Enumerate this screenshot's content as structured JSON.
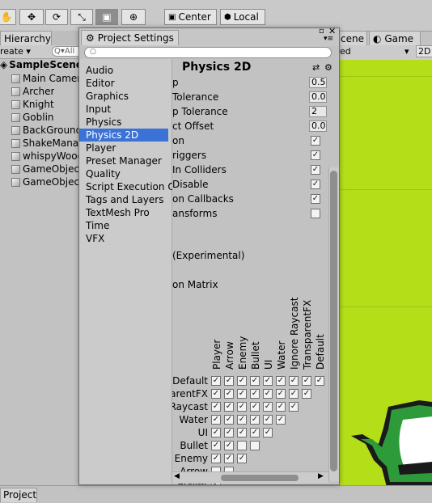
{
  "toolbar": {
    "pivot_label": "Center",
    "space_label": "Local"
  },
  "hierarchy": {
    "tab_label": "Hierarchy",
    "create_label": "reate ▾",
    "search_placeholder": "All",
    "scene_name": "SampleScene",
    "items": [
      "Main Camera",
      "Archer",
      "Knight",
      "Goblin",
      "BackGround",
      "ShakeManager",
      "whispyWood",
      "GameObject",
      "GameObject"
    ]
  },
  "scene_view": {
    "tab_label": "cene",
    "game_tab_label": "Game",
    "shading_label": "ed",
    "mode_2d": "2D",
    "bg_color": "#b4df18"
  },
  "bottom": {
    "project_tab": "Project"
  },
  "project_settings": {
    "window_title": "Project Settings",
    "search_placeholder": "",
    "categories": [
      "Audio",
      "Editor",
      "Graphics",
      "Input",
      "Physics",
      "Physics 2D",
      "Player",
      "Preset Manager",
      "Quality",
      "Script Execution O",
      "Tags and Layers",
      "TextMesh Pro",
      "Time",
      "VFX"
    ],
    "selected_category": "Physics 2D",
    "header_title": "Physics 2D",
    "settings": [
      {
        "label": "p",
        "value": "0.5"
      },
      {
        "label": " Tolerance",
        "value": "0.0"
      },
      {
        "label": "p Tolerance",
        "value": "2"
      },
      {
        "label": "ct Offset",
        "value": "0.0"
      },
      {
        "label": "on",
        "checked": true
      },
      {
        "label": "riggers",
        "checked": true
      },
      {
        "label": " In Colliders",
        "checked": true
      },
      {
        "label": " Disable",
        "checked": true
      },
      {
        "label": "on Callbacks",
        "checked": true
      },
      {
        "label": "ansforms",
        "checked": false
      }
    ],
    "experimental_label": " (Experimental)",
    "matrix_label": "on Matrix",
    "matrix_columns": [
      "Player",
      "Arrow",
      "Enemy",
      "Bullet",
      "UI",
      "Water",
      "Ignore Raycast",
      "TransparentFX",
      "Default"
    ],
    "matrix_rows": [
      {
        "label": "Default",
        "checks": [
          true,
          true,
          true,
          true,
          true,
          true,
          true,
          true,
          true
        ]
      },
      {
        "label": "arentFX",
        "checks": [
          true,
          true,
          true,
          true,
          true,
          true,
          true,
          true
        ]
      },
      {
        "label": "Raycast",
        "checks": [
          true,
          true,
          true,
          true,
          true,
          true,
          true
        ]
      },
      {
        "label": "Water",
        "checks": [
          true,
          true,
          true,
          true,
          true,
          true
        ]
      },
      {
        "label": "UI",
        "checks": [
          true,
          true,
          true,
          true,
          true
        ]
      },
      {
        "label": "Bullet",
        "checks": [
          true,
          true,
          false,
          false
        ]
      },
      {
        "label": "Enemy",
        "checks": [
          true,
          true,
          true
        ]
      },
      {
        "label": "Arrow",
        "checks": [
          false,
          false
        ]
      },
      {
        "label": "Player",
        "checks": [
          true
        ]
      }
    ]
  }
}
